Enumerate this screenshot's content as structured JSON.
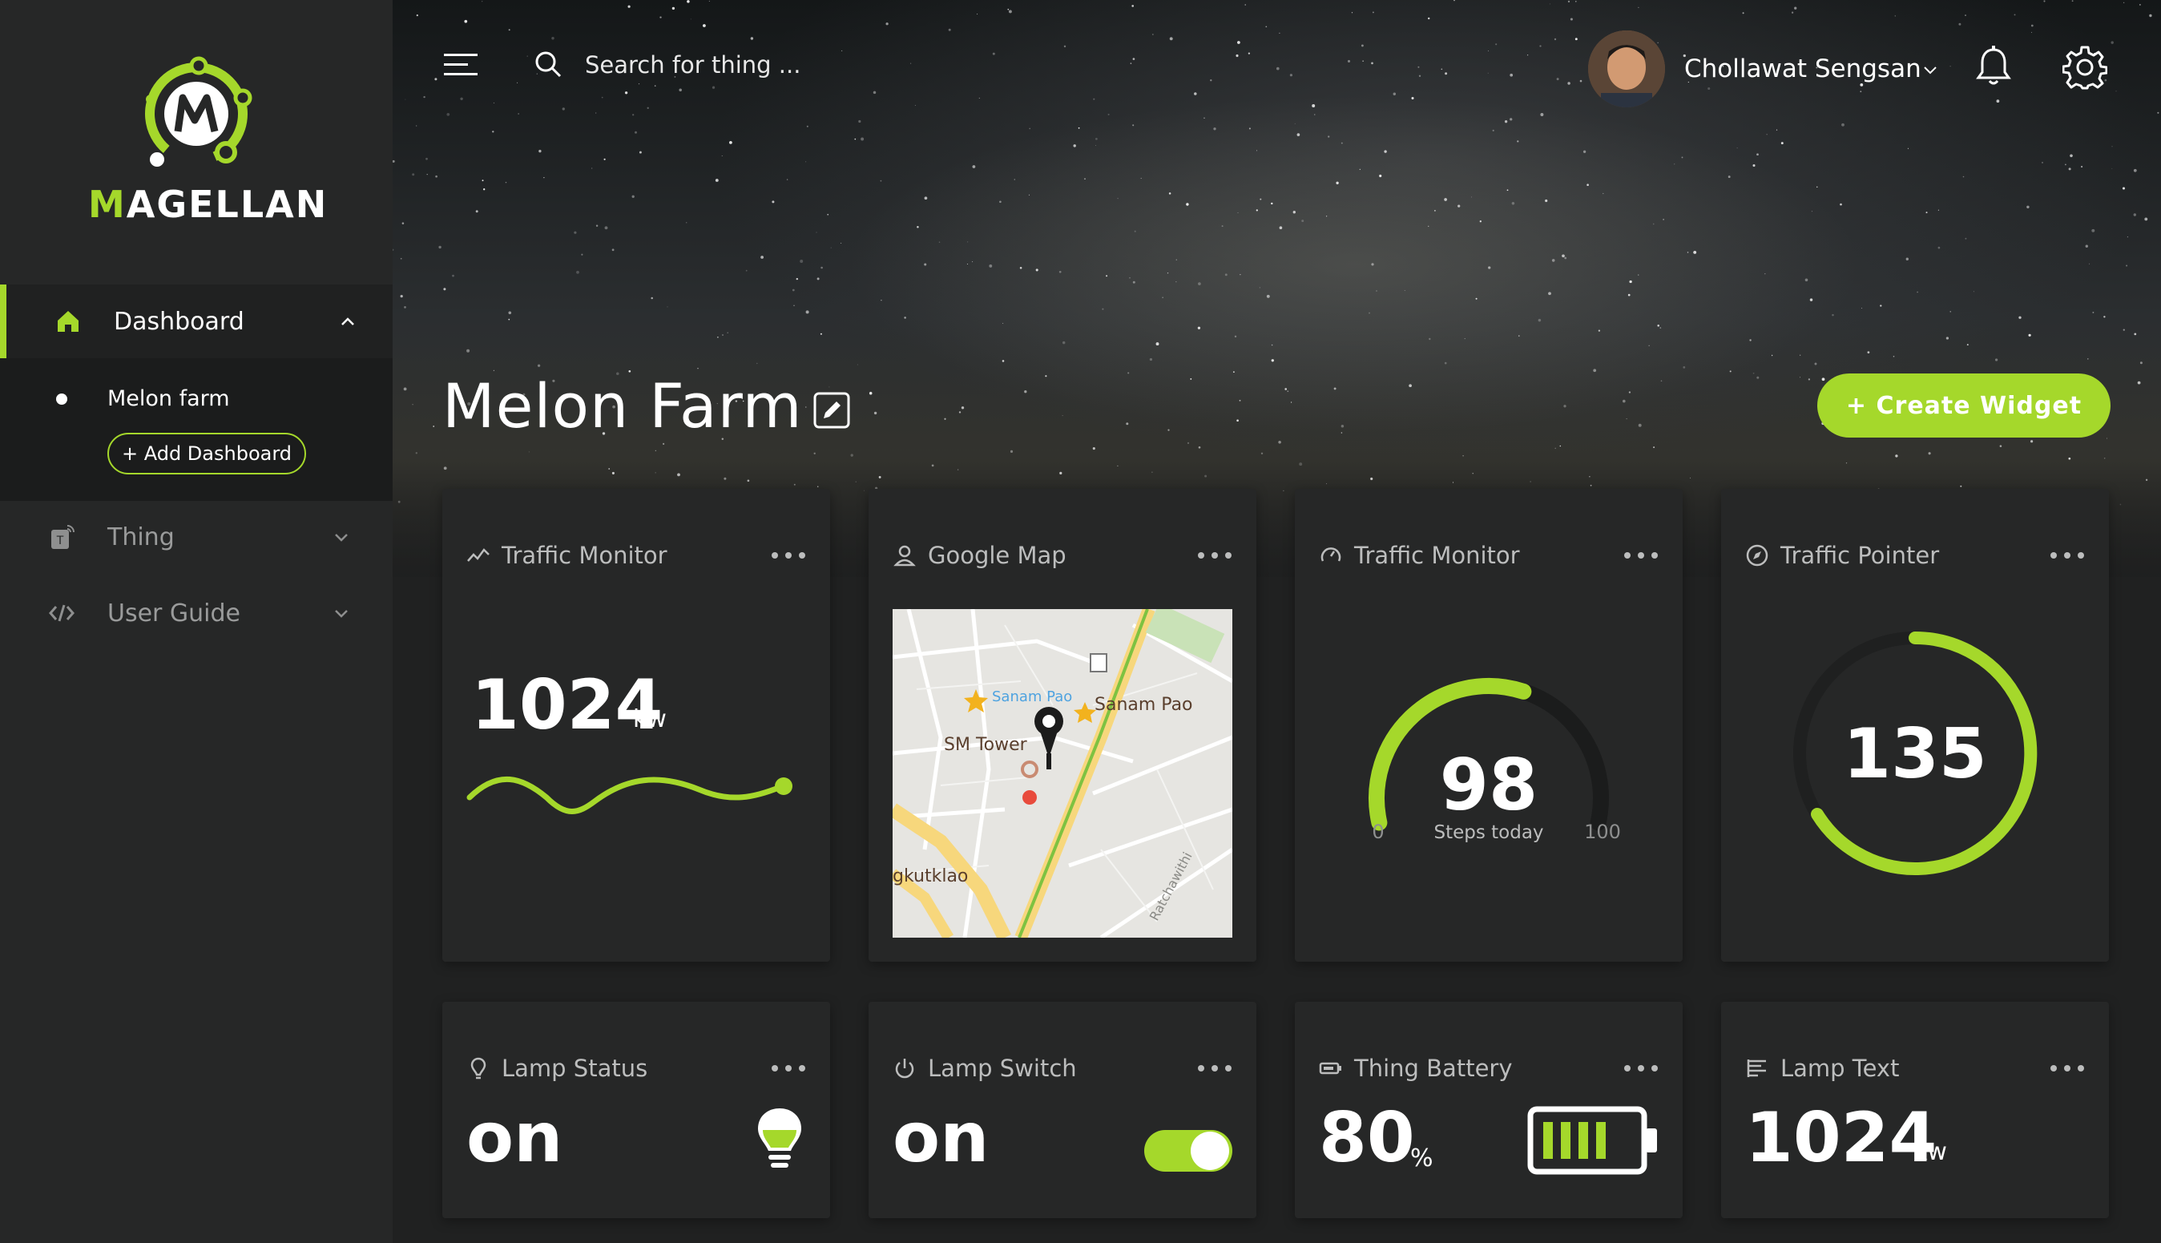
{
  "app": {
    "brand_first": "M",
    "brand_rest": "AGELLAN"
  },
  "sidebar": {
    "items": [
      {
        "label": "Dashboard",
        "icon": "home-icon",
        "active": true
      },
      {
        "label": "Thing",
        "icon": "thing-icon"
      },
      {
        "label": "User Guide",
        "icon": "code-icon"
      }
    ],
    "sub_items": [
      {
        "label": "Melon farm"
      }
    ],
    "add_dashboard_label": "+ Add Dashboard"
  },
  "header": {
    "search": {
      "placeholder": "Search for thing ..."
    },
    "user_name": "Chollawat Sengsan"
  },
  "page": {
    "title": "Melon Farm",
    "create_widget_label": "+ Create Widget"
  },
  "colors": {
    "accent": "#a5d82b",
    "card": "#262727",
    "background": "#202121"
  },
  "widgets": [
    {
      "title": "Traffic Monitor",
      "icon": "line-chart-icon",
      "value": "1024",
      "unit": "kw",
      "type": "sparkline"
    },
    {
      "title": "Google Map",
      "icon": "person-pin-icon",
      "type": "map",
      "map_labels": [
        "Sanam Pao",
        "Sanam Pao",
        "SM Tower",
        "gkutklao",
        "Ratchawithi"
      ]
    },
    {
      "title": "Traffic Monitor",
      "icon": "gauge-icon",
      "type": "gauge",
      "value": 98,
      "min_label": "0",
      "max_label": "100",
      "min": 0,
      "max": 100,
      "caption": "Steps today"
    },
    {
      "title": "Traffic Pointer",
      "icon": "compass-icon",
      "type": "ring",
      "value": "135"
    },
    {
      "title": "Lamp Status",
      "icon": "bulb-pin-icon",
      "type": "status",
      "value": "on"
    },
    {
      "title": "Lamp Switch",
      "icon": "power-icon",
      "type": "switch",
      "value": "on",
      "switch_on": true
    },
    {
      "title": "Thing Battery",
      "icon": "battery-small-icon",
      "type": "battery",
      "value": "80",
      "unit": "%",
      "level": 0.8
    },
    {
      "title": "Lamp Text",
      "icon": "text-lines-icon",
      "type": "text",
      "value": "1024",
      "unit": "kw"
    }
  ]
}
